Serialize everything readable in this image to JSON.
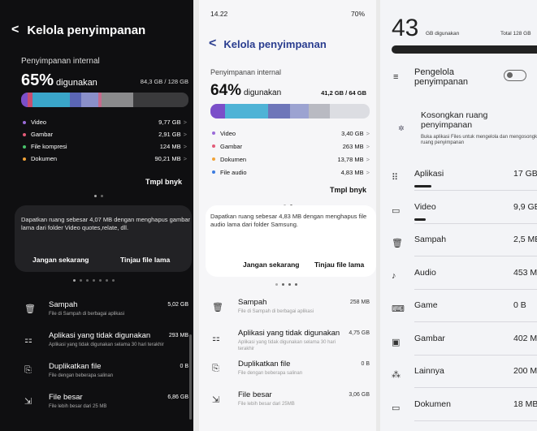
{
  "screen1": {
    "title": "Kelola penyimpanan",
    "storage_label": "Penyimpanan internal",
    "used_percent": "65%",
    "used_word": "digunakan",
    "total": "84,3 GB / 128 GB",
    "bar": [
      {
        "color": "#7b4fc9",
        "fraction": 0.04
      },
      {
        "color": "#c84d6f",
        "fraction": 0.03
      },
      {
        "color": "#3aa5c9",
        "fraction": 0.22
      },
      {
        "color": "#5b66b5",
        "fraction": 0.07
      },
      {
        "color": "#8a8fc9",
        "fraction": 0.1
      },
      {
        "color": "#c46b8c",
        "fraction": 0.02
      },
      {
        "color": "#8a8a8c",
        "fraction": 0.19
      }
    ],
    "categories": [
      {
        "label": "Video",
        "size": "9,77 GB",
        "color": "#9a6bd8"
      },
      {
        "label": "Gambar",
        "size": "2,91 GB",
        "color": "#e25b78"
      },
      {
        "label": "File kompresi",
        "size": "124 MB",
        "color": "#48c26b"
      },
      {
        "label": "Dokumen",
        "size": "90,21 MB",
        "color": "#f0a339"
      }
    ],
    "more": "Tmpl bnyk",
    "card_text": "Dapatkan ruang sebesar 4,07 MB dengan menghapus gambar lama dari folder Video quotes,relate, dll.",
    "card_btn1": "Jangan sekarang",
    "card_btn2": "Tinjau file lama",
    "items": [
      {
        "icon": "trash-icon",
        "glyph": "🗑",
        "title": "Sampah",
        "sub": "File di Sampah di berbagai aplikasi",
        "size": "5,02 GB"
      },
      {
        "icon": "apps-icon",
        "glyph": "⚏",
        "title": "Aplikasi yang tidak digunakan",
        "sub": "Aplikasi yang tidak digunakan selama 30 hari terakhir",
        "size": "293 MB"
      },
      {
        "icon": "duplicate-icon",
        "glyph": "⎘",
        "title": "Duplikatkan file",
        "sub": "File dengan beberapa salinan",
        "size": "0 B"
      },
      {
        "icon": "large-file-icon",
        "glyph": "⇲",
        "title": "File besar",
        "sub": "File lebih besar dari 25 MB",
        "size": "6,86 GB"
      }
    ]
  },
  "screen2": {
    "status_time": "14.22",
    "status_right": "70%",
    "title": "Kelola penyimpanan",
    "storage_label": "Penyimpanan internal",
    "used_percent": "64%",
    "used_word": "digunakan",
    "total": "41,2 GB / 64 GB",
    "bar": [
      {
        "color": "#7b4fc9",
        "fraction": 0.09
      },
      {
        "color": "#4fb3d6",
        "fraction": 0.27
      },
      {
        "color": "#6e76b9",
        "fraction": 0.14
      },
      {
        "color": "#9ca3d1",
        "fraction": 0.12
      },
      {
        "color": "#b9bac2",
        "fraction": 0.13
      }
    ],
    "categories": [
      {
        "label": "Video",
        "size": "3,40 GB",
        "color": "#9a6bd8"
      },
      {
        "label": "Gambar",
        "size": "263 MB",
        "color": "#e25b78"
      },
      {
        "label": "Dokumen",
        "size": "13,78 MB",
        "color": "#f0a339"
      },
      {
        "label": "File audio",
        "size": "4,83 MB",
        "color": "#3b7be0"
      }
    ],
    "more": "Tmpl bnyk",
    "card_text": "Dapatkan ruang sebesar 4,83 MB dengan menghapus file audio lama dari folder Samsung.",
    "card_btn1": "Jangan sekarang",
    "card_btn2": "Tinjau file lama",
    "items": [
      {
        "icon": "trash-icon",
        "glyph": "🗑",
        "title": "Sampah",
        "sub": "File di Sampah di berbagai aplikasi",
        "size": "258 MB"
      },
      {
        "icon": "apps-icon",
        "glyph": "⚏",
        "title": "Aplikasi yang tidak digunakan",
        "sub": "Aplikasi yang tidak digunakan selama 30 hari terakhir",
        "size": "4,75 GB"
      },
      {
        "icon": "duplicate-icon",
        "glyph": "⎘",
        "title": "Duplikatkan file",
        "sub": "File dengan beberapa salinan",
        "size": "0 B"
      },
      {
        "icon": "large-file-icon",
        "glyph": "⇲",
        "title": "File besar",
        "sub": "File lebih besar dari 25MB",
        "size": "3,06 GB"
      }
    ]
  },
  "screen3": {
    "used_number": "43",
    "used_unit": "GB digunakan",
    "total": "Total 128 GB",
    "manager_label": "Pengelola penyimpanan",
    "free_title": "Kosongkan ruang penyimpanan",
    "free_sub": "Buka aplikasi Files untuk mengelola dan mengosongkan ruang penyimpanan",
    "categories": [
      {
        "icon": "apps-grid-icon",
        "glyph": "⠿",
        "label": "Aplikasi",
        "size": "17 GB",
        "fraction": 0.12
      },
      {
        "icon": "video-icon",
        "glyph": "▭",
        "label": "Video",
        "size": "9,9 GB",
        "fraction": 0.08
      },
      {
        "icon": "trash-icon",
        "glyph": "🗑",
        "label": "Sampah",
        "size": "2,5 MB",
        "fraction": 0
      },
      {
        "icon": "music-icon",
        "glyph": "♪",
        "label": "Audio",
        "size": "453 MB",
        "fraction": 0
      },
      {
        "icon": "game-icon",
        "glyph": "⌨",
        "label": "Game",
        "size": "0 B",
        "fraction": 0
      },
      {
        "icon": "image-icon",
        "glyph": "▣",
        "label": "Gambar",
        "size": "402 MB",
        "fraction": 0
      },
      {
        "icon": "shapes-icon",
        "glyph": "⁂",
        "label": "Lainnya",
        "size": "200 MB",
        "fraction": 0
      },
      {
        "icon": "folder-icon",
        "glyph": "▭",
        "label": "Dokumen",
        "size": "18 MB",
        "fraction": 0
      }
    ]
  }
}
